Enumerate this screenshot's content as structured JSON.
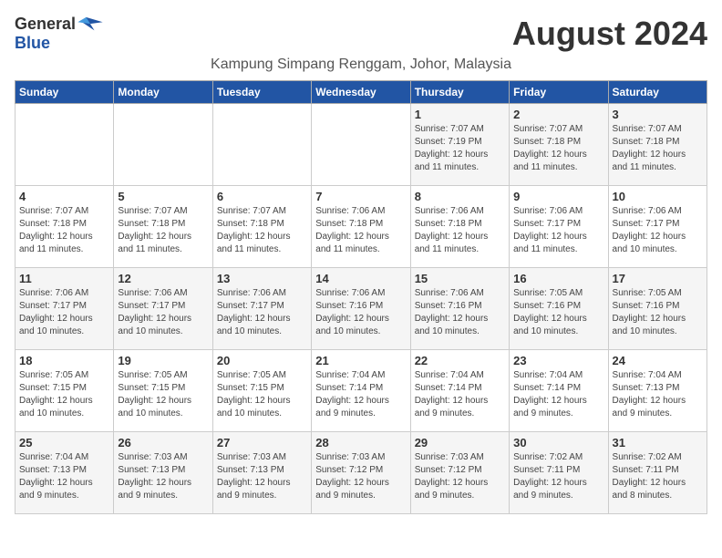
{
  "header": {
    "logo_general": "General",
    "logo_blue": "Blue",
    "month_title": "August 2024",
    "location": "Kampung Simpang Renggam, Johor, Malaysia"
  },
  "weekdays": [
    "Sunday",
    "Monday",
    "Tuesday",
    "Wednesday",
    "Thursday",
    "Friday",
    "Saturday"
  ],
  "weeks": [
    [
      {
        "day": "",
        "sunrise": "",
        "sunset": "",
        "daylight": ""
      },
      {
        "day": "",
        "sunrise": "",
        "sunset": "",
        "daylight": ""
      },
      {
        "day": "",
        "sunrise": "",
        "sunset": "",
        "daylight": ""
      },
      {
        "day": "",
        "sunrise": "",
        "sunset": "",
        "daylight": ""
      },
      {
        "day": "1",
        "sunrise": "7:07 AM",
        "sunset": "7:19 PM",
        "daylight": "12 hours and 11 minutes."
      },
      {
        "day": "2",
        "sunrise": "7:07 AM",
        "sunset": "7:18 PM",
        "daylight": "12 hours and 11 minutes."
      },
      {
        "day": "3",
        "sunrise": "7:07 AM",
        "sunset": "7:18 PM",
        "daylight": "12 hours and 11 minutes."
      }
    ],
    [
      {
        "day": "4",
        "sunrise": "7:07 AM",
        "sunset": "7:18 PM",
        "daylight": "12 hours and 11 minutes."
      },
      {
        "day": "5",
        "sunrise": "7:07 AM",
        "sunset": "7:18 PM",
        "daylight": "12 hours and 11 minutes."
      },
      {
        "day": "6",
        "sunrise": "7:07 AM",
        "sunset": "7:18 PM",
        "daylight": "12 hours and 11 minutes."
      },
      {
        "day": "7",
        "sunrise": "7:06 AM",
        "sunset": "7:18 PM",
        "daylight": "12 hours and 11 minutes."
      },
      {
        "day": "8",
        "sunrise": "7:06 AM",
        "sunset": "7:18 PM",
        "daylight": "12 hours and 11 minutes."
      },
      {
        "day": "9",
        "sunrise": "7:06 AM",
        "sunset": "7:17 PM",
        "daylight": "12 hours and 11 minutes."
      },
      {
        "day": "10",
        "sunrise": "7:06 AM",
        "sunset": "7:17 PM",
        "daylight": "12 hours and 10 minutes."
      }
    ],
    [
      {
        "day": "11",
        "sunrise": "7:06 AM",
        "sunset": "7:17 PM",
        "daylight": "12 hours and 10 minutes."
      },
      {
        "day": "12",
        "sunrise": "7:06 AM",
        "sunset": "7:17 PM",
        "daylight": "12 hours and 10 minutes."
      },
      {
        "day": "13",
        "sunrise": "7:06 AM",
        "sunset": "7:17 PM",
        "daylight": "12 hours and 10 minutes."
      },
      {
        "day": "14",
        "sunrise": "7:06 AM",
        "sunset": "7:16 PM",
        "daylight": "12 hours and 10 minutes."
      },
      {
        "day": "15",
        "sunrise": "7:06 AM",
        "sunset": "7:16 PM",
        "daylight": "12 hours and 10 minutes."
      },
      {
        "day": "16",
        "sunrise": "7:05 AM",
        "sunset": "7:16 PM",
        "daylight": "12 hours and 10 minutes."
      },
      {
        "day": "17",
        "sunrise": "7:05 AM",
        "sunset": "7:16 PM",
        "daylight": "12 hours and 10 minutes."
      }
    ],
    [
      {
        "day": "18",
        "sunrise": "7:05 AM",
        "sunset": "7:15 PM",
        "daylight": "12 hours and 10 minutes."
      },
      {
        "day": "19",
        "sunrise": "7:05 AM",
        "sunset": "7:15 PM",
        "daylight": "12 hours and 10 minutes."
      },
      {
        "day": "20",
        "sunrise": "7:05 AM",
        "sunset": "7:15 PM",
        "daylight": "12 hours and 10 minutes."
      },
      {
        "day": "21",
        "sunrise": "7:04 AM",
        "sunset": "7:14 PM",
        "daylight": "12 hours and 9 minutes."
      },
      {
        "day": "22",
        "sunrise": "7:04 AM",
        "sunset": "7:14 PM",
        "daylight": "12 hours and 9 minutes."
      },
      {
        "day": "23",
        "sunrise": "7:04 AM",
        "sunset": "7:14 PM",
        "daylight": "12 hours and 9 minutes."
      },
      {
        "day": "24",
        "sunrise": "7:04 AM",
        "sunset": "7:13 PM",
        "daylight": "12 hours and 9 minutes."
      }
    ],
    [
      {
        "day": "25",
        "sunrise": "7:04 AM",
        "sunset": "7:13 PM",
        "daylight": "12 hours and 9 minutes."
      },
      {
        "day": "26",
        "sunrise": "7:03 AM",
        "sunset": "7:13 PM",
        "daylight": "12 hours and 9 minutes."
      },
      {
        "day": "27",
        "sunrise": "7:03 AM",
        "sunset": "7:13 PM",
        "daylight": "12 hours and 9 minutes."
      },
      {
        "day": "28",
        "sunrise": "7:03 AM",
        "sunset": "7:12 PM",
        "daylight": "12 hours and 9 minutes."
      },
      {
        "day": "29",
        "sunrise": "7:03 AM",
        "sunset": "7:12 PM",
        "daylight": "12 hours and 9 minutes."
      },
      {
        "day": "30",
        "sunrise": "7:02 AM",
        "sunset": "7:11 PM",
        "daylight": "12 hours and 9 minutes."
      },
      {
        "day": "31",
        "sunrise": "7:02 AM",
        "sunset": "7:11 PM",
        "daylight": "12 hours and 8 minutes."
      }
    ]
  ]
}
